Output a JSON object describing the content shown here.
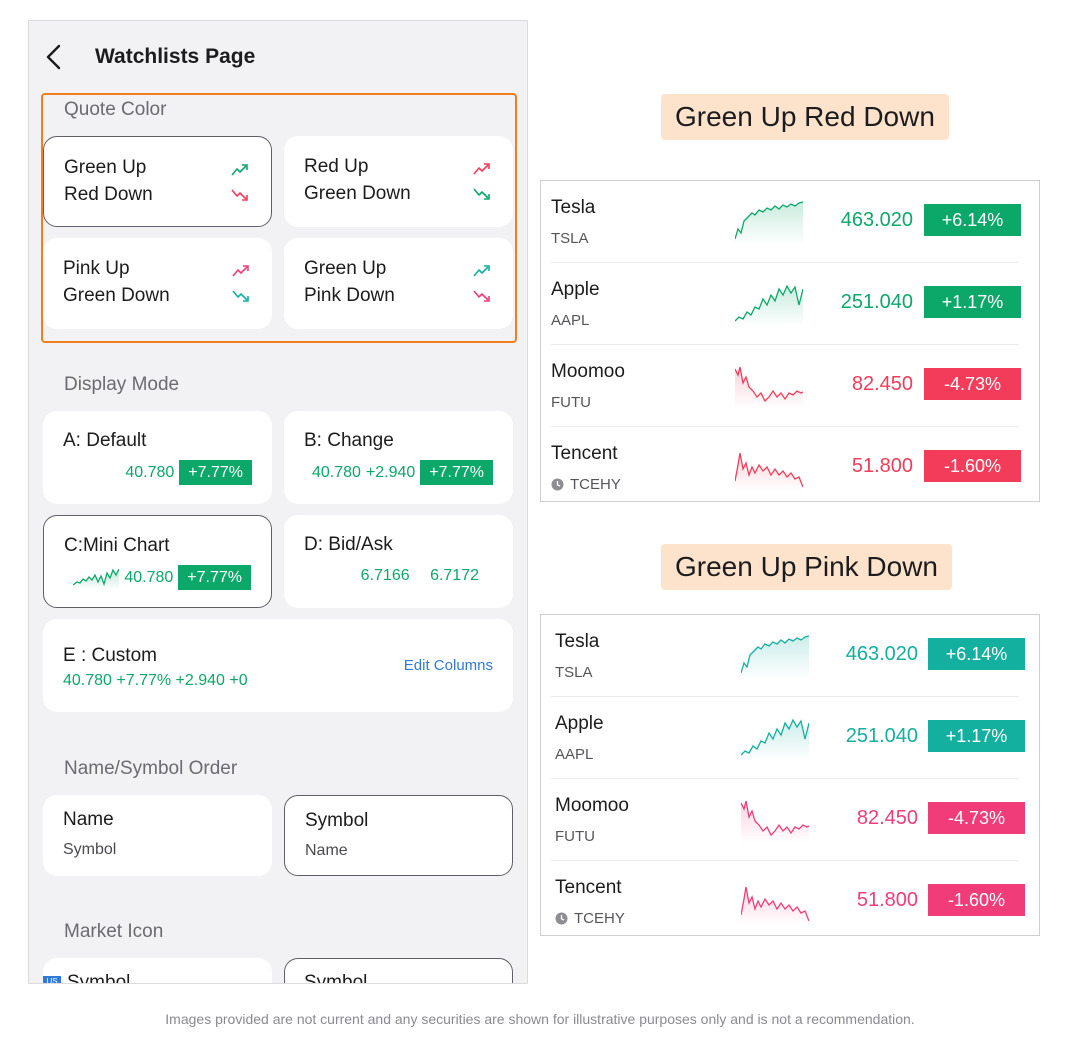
{
  "colors": {
    "green": "#0ca86a",
    "red": "#f23c59",
    "teal": "#13b0a0",
    "pink": "#f03c78",
    "accent_orange": "#f0801f",
    "link_blue": "#2f7ad8"
  },
  "phone": {
    "title": "Watchlists Page",
    "back_icon": "chevron-left-icon",
    "quote_color": {
      "heading": "Quote Color",
      "options": [
        {
          "line1": "Green Up",
          "line2": "Red Down",
          "up_color": "#0ca86a",
          "down_color": "#f23c59",
          "selected": true
        },
        {
          "line1": "Red Up",
          "line2": "Green Down",
          "up_color": "#f23c59",
          "down_color": "#0ca86a",
          "selected": false
        },
        {
          "line1": "Pink Up",
          "line2": "Green Down",
          "up_color": "#f03c78",
          "down_color": "#13b0a0",
          "selected": false
        },
        {
          "line1": "Green Up",
          "line2": "Pink Down",
          "up_color": "#13b0a0",
          "down_color": "#f03c78",
          "selected": false
        }
      ]
    },
    "display_mode": {
      "heading": "Display Mode",
      "default": {
        "title": "A: Default",
        "price": "40.780",
        "pct": "+7.77%"
      },
      "change": {
        "title": "B: Change",
        "price": "40.780",
        "change": "+2.940",
        "pct": "+7.77%"
      },
      "mini_chart": {
        "title": "C:Mini Chart",
        "price": "40.780",
        "pct": "+7.77%",
        "selected": true
      },
      "bid_ask": {
        "title": "D: Bid/Ask",
        "bid": "6.7166",
        "ask": "6.7172"
      },
      "custom": {
        "title": "E : Custom",
        "values": "40.780 +7.77% +2.940 +0",
        "edit_label": "Edit Columns"
      }
    },
    "name_order": {
      "heading": "Name/Symbol Order",
      "options": [
        {
          "line1": "Name",
          "line2": "Symbol",
          "selected": false
        },
        {
          "line1": "Symbol",
          "line2": "Name",
          "selected": true
        }
      ]
    },
    "market_icon": {
      "heading": "Market Icon",
      "badge": "US",
      "options": [
        {
          "label": "Symbol"
        },
        {
          "label": "Symbol"
        }
      ]
    }
  },
  "previews": [
    {
      "label": "Green Up Red Down",
      "rows": [
        {
          "name": "Tesla",
          "symbol": "TSLA",
          "price": "463.020",
          "change": "+6.14%",
          "direction": "up",
          "clock": false
        },
        {
          "name": "Apple",
          "symbol": "AAPL",
          "price": "251.040",
          "change": "+1.17%",
          "direction": "up",
          "clock": false
        },
        {
          "name": "Moomoo",
          "symbol": "FUTU",
          "price": "82.450",
          "change": "-4.73%",
          "direction": "down",
          "clock": false
        },
        {
          "name": "Tencent",
          "symbol": "TCEHY",
          "price": "51.800",
          "change": "-1.60%",
          "direction": "down",
          "clock": true
        }
      ],
      "up_color": "#0ca86a",
      "down_color": "#f23c59"
    },
    {
      "label": "Green Up Pink Down",
      "rows": [
        {
          "name": "Tesla",
          "symbol": "TSLA",
          "price": "463.020",
          "change": "+6.14%",
          "direction": "up",
          "clock": false
        },
        {
          "name": "Apple",
          "symbol": "AAPL",
          "price": "251.040",
          "change": "+1.17%",
          "direction": "up",
          "clock": false
        },
        {
          "name": "Moomoo",
          "symbol": "FUTU",
          "price": "82.450",
          "change": "-4.73%",
          "direction": "down",
          "clock": false
        },
        {
          "name": "Tencent",
          "symbol": "TCEHY",
          "price": "51.800",
          "change": "-1.60%",
          "direction": "down",
          "clock": true
        }
      ],
      "up_color": "#13b0a0",
      "down_color": "#f03c78"
    }
  ],
  "disclaimer": "Images provided are not current and any securities are shown for illustrative purposes only and is not a recommendation."
}
